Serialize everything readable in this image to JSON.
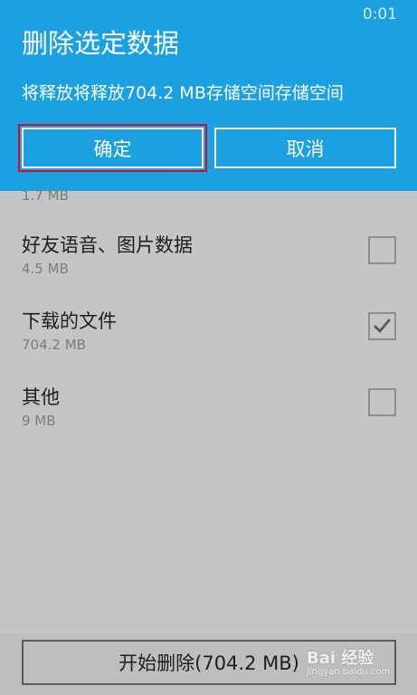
{
  "status_bar": {
    "time": "0:01"
  },
  "dialog": {
    "title": "删除选定数据",
    "message": "将释放将释放704.2 MB存储空间存储空间",
    "ok_label": "确定",
    "cancel_label": "取消"
  },
  "list": {
    "partial_item_size": "1.7 MB",
    "items": [
      {
        "title": "好友语音、图片数据",
        "size": "4.5 MB",
        "checked": false
      },
      {
        "title": "下载的文件",
        "size": "704.2 MB",
        "checked": true
      },
      {
        "title": "其他",
        "size": "9 MB",
        "checked": false
      }
    ]
  },
  "bottom": {
    "start_delete_label": "开始删除(704.2 MB)"
  },
  "watermark": {
    "logo": "Bai 经验",
    "url": "jingyan.baidu.com"
  },
  "colors": {
    "accent": "#1ba1e2",
    "highlight": "#c8102e",
    "background": "#c4c5c6"
  }
}
